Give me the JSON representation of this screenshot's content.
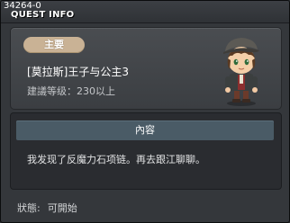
{
  "window": {
    "quest_id": "34264-0",
    "title": "QUEST INFO"
  },
  "quest": {
    "type_badge": "主要",
    "name": "[莫拉斯]王子与公主3",
    "recommended_level": "建議等级：230以上",
    "npc_portrait_icon": "npc-portrait-icon"
  },
  "content": {
    "header": "內容",
    "text": "我发现了反魔力石项链。再去跟江聊聊。"
  },
  "status": {
    "label": "狀態:",
    "value": "可開始"
  },
  "colors": {
    "background": "#34373b",
    "badge": "#c9b295",
    "content_header": "#4a5b66",
    "content_bg": "#2a2c30"
  }
}
